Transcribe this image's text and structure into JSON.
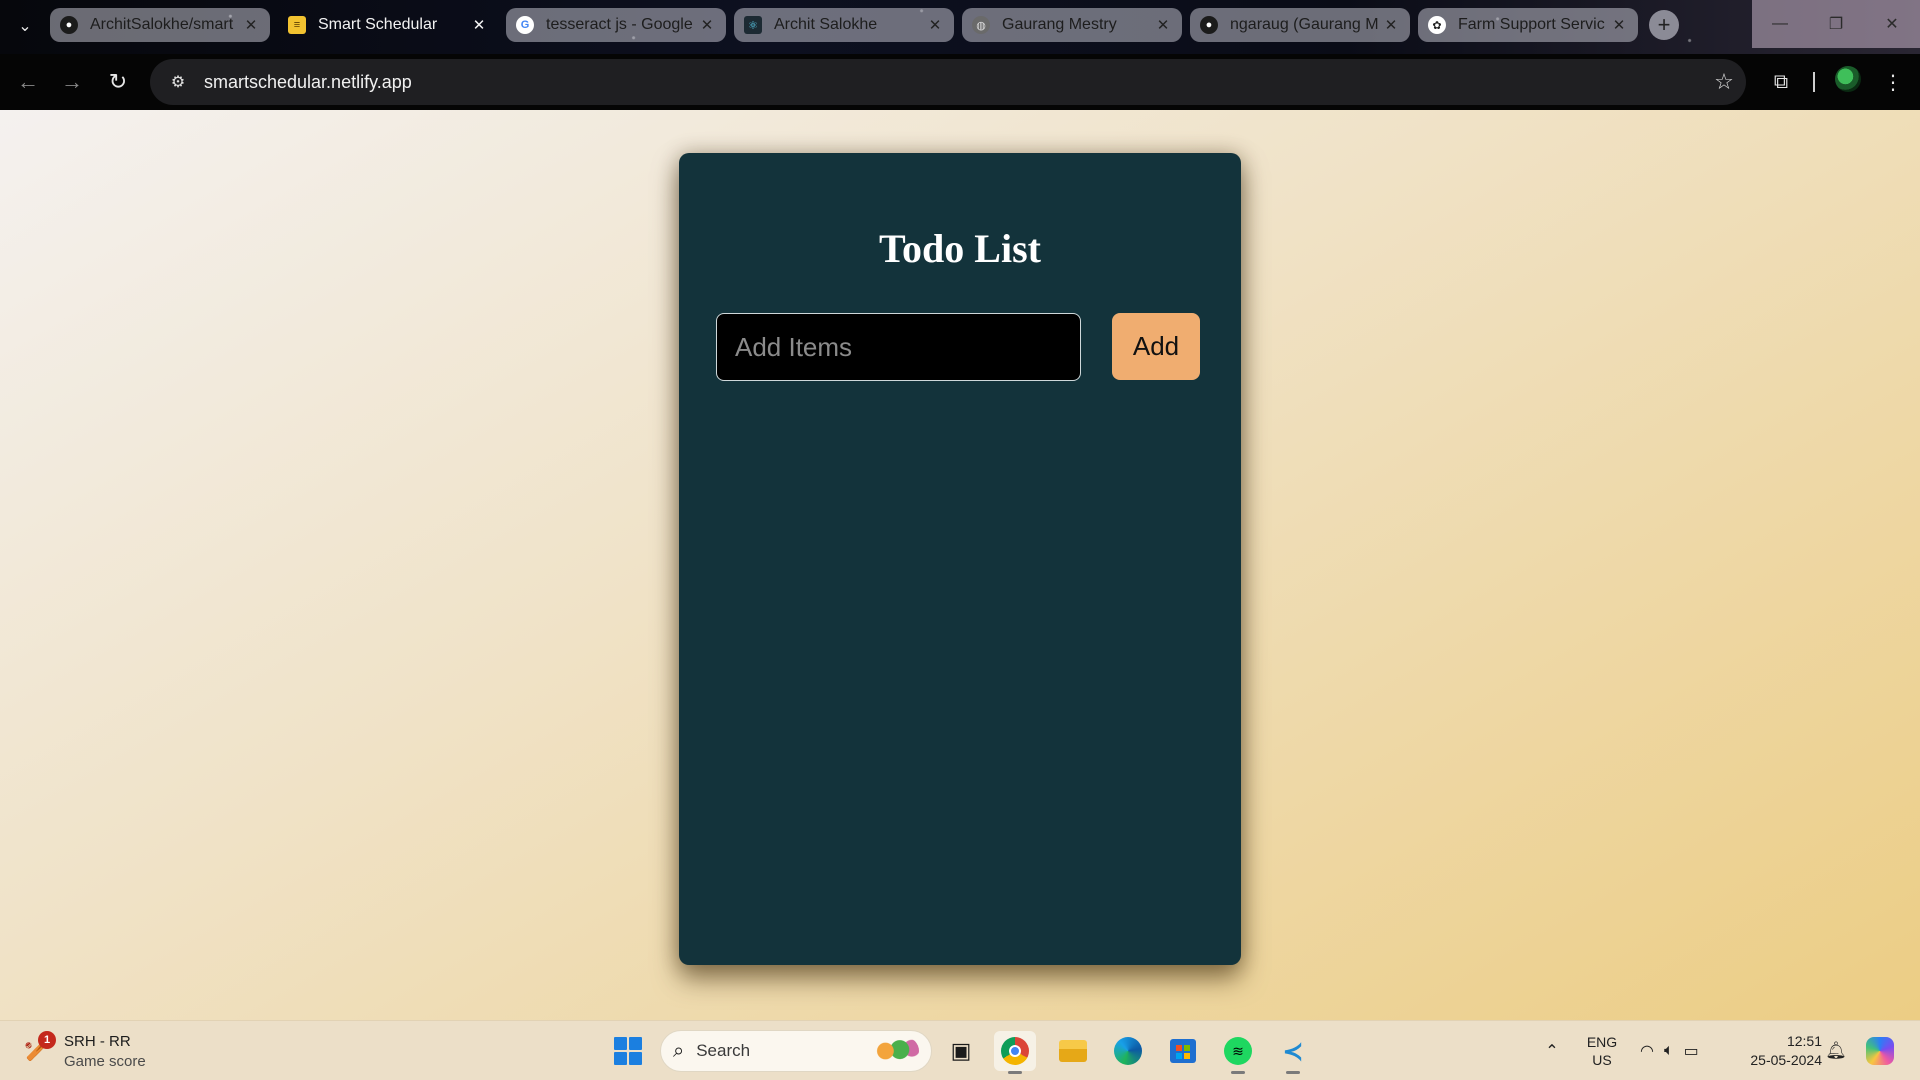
{
  "browser": {
    "tabs": [
      {
        "title": "ArchitSalokhe/smart",
        "favicon": "github-icon",
        "active": false
      },
      {
        "title": "Smart Schedular",
        "favicon": "notepad-icon",
        "active": true
      },
      {
        "title": "tesseract js - Google",
        "favicon": "google-icon",
        "active": false
      },
      {
        "title": "Archit Salokhe",
        "favicon": "react-icon",
        "active": false
      },
      {
        "title": "Gaurang Mestry",
        "favicon": "globe-icon",
        "active": false
      },
      {
        "title": "ngaraug (Gaurang M",
        "favicon": "github-icon",
        "active": false
      },
      {
        "title": "Farm Support Servic",
        "favicon": "openai-icon",
        "active": false
      }
    ],
    "address_bar": {
      "url": "smartschedular.netlify.app"
    }
  },
  "app": {
    "title": "Todo List",
    "input_placeholder": "Add Items",
    "input_value": "",
    "add_button_label": "Add",
    "items": [],
    "colors": {
      "card_background": "#13333b",
      "button_background": "#f0ad70",
      "input_background": "#000000"
    }
  },
  "taskbar": {
    "widget": {
      "title": "SRH - RR",
      "subtitle": "Game score",
      "badge": "1"
    },
    "search_label": "Search",
    "apps": [
      "chrome-icon",
      "file-explorer-icon",
      "edge-icon",
      "store-icon",
      "spotify-icon",
      "vscode-icon"
    ],
    "language": {
      "line1": "ENG",
      "line2": "US"
    },
    "clock": {
      "time": "12:51",
      "date": "25-05-2024"
    }
  }
}
